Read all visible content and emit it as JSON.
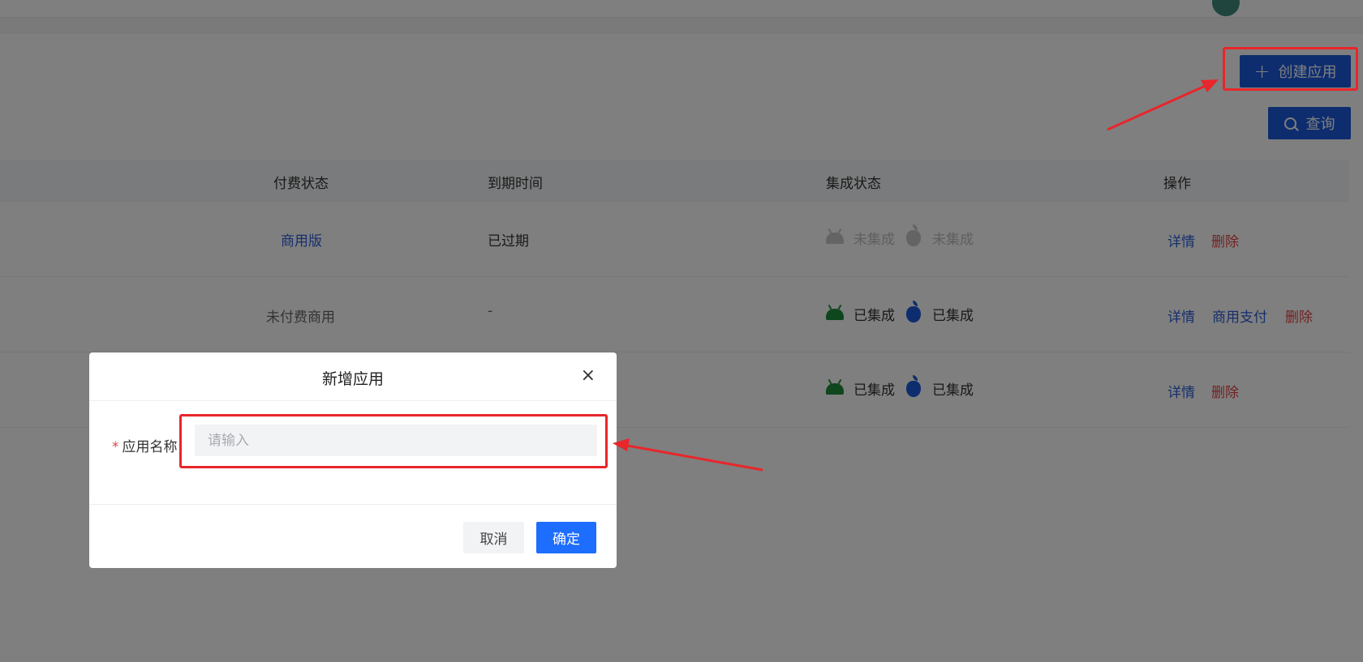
{
  "toolbar": {
    "create_label": "创建应用",
    "query_label": "查询"
  },
  "table": {
    "headers": [
      "付费状态",
      "到期时间",
      "集成状态",
      "操作"
    ],
    "rows": [
      {
        "pay_status": "商用版",
        "expire": "已过期",
        "android_status": "未集成",
        "ios_status": "未集成",
        "actions": [
          "详情",
          "删除"
        ]
      },
      {
        "pay_status": "未付费商用",
        "expire": "-",
        "android_status": "已集成",
        "ios_status": "已集成",
        "actions": [
          "详情",
          "商用支付",
          "删除"
        ]
      },
      {
        "pay_status": "",
        "expire": "",
        "android_status": "已集成",
        "ios_status": "已集成",
        "actions": [
          "详情",
          "删除"
        ]
      }
    ]
  },
  "modal": {
    "title": "新增应用",
    "close": "×",
    "field_required": "*",
    "field_label": "应用名称",
    "field_placeholder": "请输入",
    "cancel_label": "取消",
    "ok_label": "确定"
  },
  "colors": {
    "primary": "#1d5bdc",
    "ok_button": "#1d6dff",
    "danger": "#e54545",
    "android": "#1c8f3a",
    "annotation": "#e8262b"
  }
}
